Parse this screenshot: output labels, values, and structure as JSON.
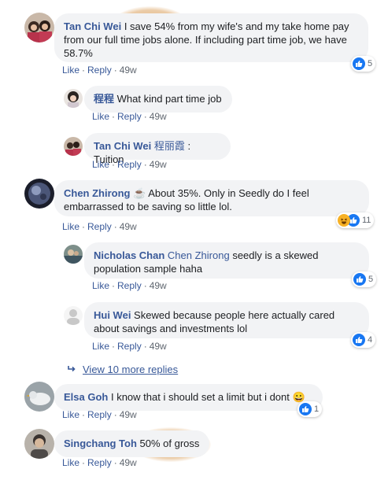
{
  "comments": [
    {
      "author": "Tan Chi Wei",
      "text": " I save 54% from my wife's and my take home pay from our full time jobs alone. If including part time job, we have 58.7%",
      "like": "Like",
      "reply": "Reply",
      "time": "49w",
      "reactions": {
        "count": "5",
        "types": [
          "like"
        ]
      }
    },
    {
      "author": "程程",
      "text": " What kind part time job",
      "like": "Like",
      "reply": "Reply",
      "time": "49w"
    },
    {
      "author": "Tan Chi Wei",
      "mention": "程丽霞",
      "text": " : Tuition",
      "like": "Like",
      "reply": "Reply",
      "time": "49w"
    },
    {
      "author": "Chen Zhirong",
      "text": " ☕ About 35%. Only in Seedly do I feel embarrassed to be saving so little lol.",
      "like": "Like",
      "reply": "Reply",
      "time": "49w",
      "reactions": {
        "count": "11",
        "types": [
          "haha",
          "like"
        ]
      }
    },
    {
      "author": "Nicholas Chan",
      "mention": "Chen Zhirong",
      "text": " seedly is a skewed population sample haha",
      "like": "Like",
      "reply": "Reply",
      "time": "49w",
      "reactions": {
        "count": "5",
        "types": [
          "like"
        ]
      }
    },
    {
      "author": "Hui Wei",
      "text": " Skewed because people here actually cared about savings and investments lol",
      "like": "Like",
      "reply": "Reply",
      "time": "49w",
      "reactions": {
        "count": "4",
        "types": [
          "like"
        ]
      }
    },
    {
      "author": "Elsa Goh",
      "text": " I know that i should set a limit but i dont 😀",
      "like": "Like",
      "reply": "Reply",
      "time": "49w",
      "reactions": {
        "count": "1",
        "types": [
          "like"
        ]
      }
    },
    {
      "author": "Singchang Toh",
      "text": " 50% of gross",
      "like": "Like",
      "reply": "Reply",
      "time": "49w"
    }
  ],
  "view_more": {
    "icon": "reply-arrow-icon",
    "label": "View 10 more replies"
  },
  "colors": {
    "link": "#385898",
    "bubble": "#f2f3f5",
    "like_blue": "#1877f2",
    "highlight": "#deaa6e"
  }
}
